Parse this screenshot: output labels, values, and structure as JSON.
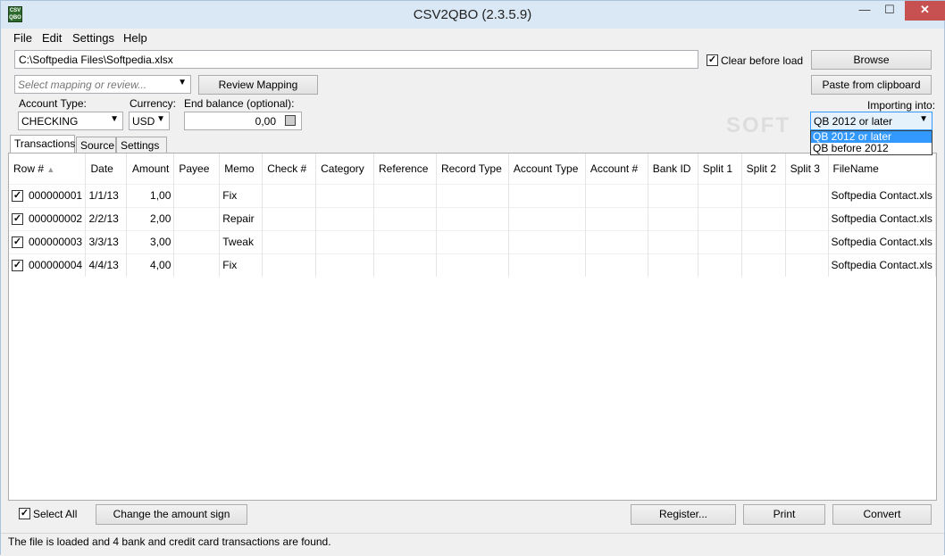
{
  "window": {
    "title": "CSV2QBO (2.3.5.9)",
    "icon_label": [
      "CSV",
      "QBO"
    ]
  },
  "menu": [
    "File",
    "Edit",
    "Settings",
    "Help"
  ],
  "file_path": "C:\\Softpedia Files\\Softpedia.xlsx",
  "clear_before_load": {
    "label": "Clear before load",
    "checked": "✓"
  },
  "browse_label": "Browse",
  "mapping": {
    "placeholder": "Select mapping or review...",
    "review_label": "Review Mapping"
  },
  "paste_label": "Paste from clipboard",
  "account_type": {
    "label": "Account Type:",
    "value": "CHECKING"
  },
  "currency": {
    "label": "Currency:",
    "value": "USD"
  },
  "end_balance": {
    "label": "End balance (optional):",
    "value": "0,00"
  },
  "importing": {
    "label": "Importing into:",
    "value": "QB 2012 or later",
    "options": [
      "QB 2012 or later",
      "QB before 2012"
    ]
  },
  "tabs": [
    "Transactions",
    "Source",
    "Settings"
  ],
  "columns": [
    "Row #",
    "Date",
    "Amount",
    "Payee",
    "Memo",
    "Check #",
    "Category",
    "Reference",
    "Record Type",
    "Account Type",
    "Account #",
    "Bank ID",
    "Split 1",
    "Split 2",
    "Split 3",
    "FileName"
  ],
  "rows": [
    {
      "check": "✓",
      "row": "000000001",
      "date": "1/1/13",
      "amount": "1,00",
      "memo": "Fix",
      "file": "Softpedia Contact.xls"
    },
    {
      "check": "✓",
      "row": "000000002",
      "date": "2/2/13",
      "amount": "2,00",
      "memo": "Repair",
      "file": "Softpedia Contact.xls"
    },
    {
      "check": "✓",
      "row": "000000003",
      "date": "3/3/13",
      "amount": "3,00",
      "memo": "Tweak",
      "file": "Softpedia Contact.xls"
    },
    {
      "check": "✓",
      "row": "000000004",
      "date": "4/4/13",
      "amount": "4,00",
      "memo": "Fix",
      "file": "Softpedia Contact.xls"
    }
  ],
  "select_all": {
    "label": "Select All",
    "checked": "✓"
  },
  "change_sign_label": "Change the amount sign",
  "register_label": "Register...",
  "print_label": "Print",
  "convert_label": "Convert",
  "status": "The file is loaded and 4 bank and credit card transactions are found.",
  "watermark": "SOFT",
  "colors": {
    "accent": "#3399ff",
    "close": "#c75050",
    "titlebar": "#d9e8f4"
  }
}
